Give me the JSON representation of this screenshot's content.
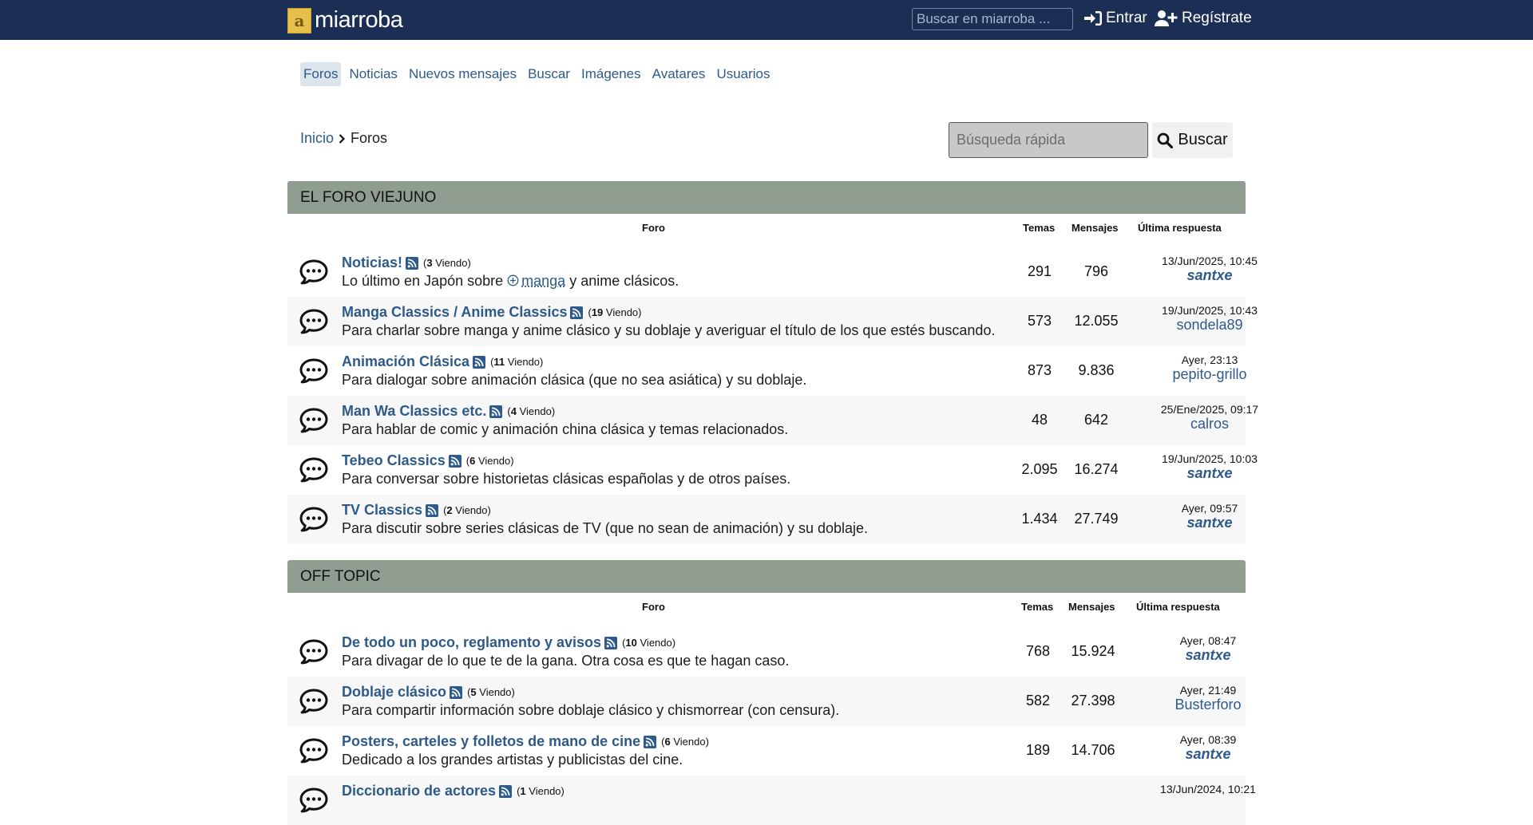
{
  "topbar": {
    "logo_mark": "a",
    "logo_text": "miarroba",
    "search_placeholder": "Buscar en miarroba ...",
    "login_label": "Entrar",
    "register_label": "Regístrate"
  },
  "nav": {
    "items": [
      "Foros",
      "Noticias",
      "Nuevos mensajes",
      "Buscar",
      "Imágenes",
      "Avatares",
      "Usuarios"
    ]
  },
  "breadcrumb": {
    "home": "Inicio",
    "current": "Foros"
  },
  "quick_search": {
    "placeholder": "Búsqueda rápida",
    "button": "Buscar"
  },
  "columns": {
    "forum": "Foro",
    "topics": "Temas",
    "posts": "Mensajes",
    "last": "Última respuesta"
  },
  "categories": [
    {
      "title": "EL FORO VIEJUNO",
      "forums": [
        {
          "title": "Noticias!",
          "viewing": "3",
          "viewing_label": "Viendo",
          "desc_pre": "Lo último en Japón sobre ",
          "desc_link": "manga",
          "desc_post": " y anime clásicos.",
          "topics": "291",
          "posts": "796",
          "last_date": "13/Jun/2025, 10:45",
          "last_user": "santxe"
        },
        {
          "title": "Manga Classics / Anime Classics",
          "viewing": "19",
          "viewing_label": "Viendo",
          "desc": "Para charlar sobre manga y anime clásico y su doblaje y averiguar el título de los que estés buscando.",
          "topics": "573",
          "posts": "12.055",
          "last_date": "19/Jun/2025, 10:43",
          "last_user": "sondela89"
        },
        {
          "title": "Animación Clásica",
          "viewing": "11",
          "viewing_label": "Viendo",
          "desc": "Para dialogar sobre animación clásica (que no sea asiática) y su doblaje.",
          "topics": "873",
          "posts": "9.836",
          "last_date": "Ayer, 23:13",
          "last_user": "pepito-grillo"
        },
        {
          "title": "Man Wa Classics etc.",
          "viewing": "4",
          "viewing_label": "Viendo",
          "desc": "Para hablar de comic y animación china clásica y temas relacionados.",
          "topics": "48",
          "posts": "642",
          "last_date": "25/Ene/2025, 09:17",
          "last_user": "calros"
        },
        {
          "title": "Tebeo Classics",
          "viewing": "6",
          "viewing_label": "Viendo",
          "desc": "Para conversar sobre historietas clásicas españolas y de otros países.",
          "topics": "2.095",
          "posts": "16.274",
          "last_date": "19/Jun/2025, 10:03",
          "last_user": "santxe"
        },
        {
          "title": "TV Classics",
          "viewing": "2",
          "viewing_label": "Viendo",
          "desc": "Para discutir sobre series clásicas de TV (que no sean de animación) y su doblaje.",
          "topics": "1.434",
          "posts": "27.749",
          "last_date": "Ayer, 09:57",
          "last_user": "santxe"
        }
      ]
    },
    {
      "title": "OFF TOPIC",
      "forums": [
        {
          "title": "De todo un poco, reglamento y avisos",
          "viewing": "10",
          "viewing_label": "Viendo",
          "desc": "Para divagar de lo que te de la gana. Otra cosa es que te hagan caso.",
          "topics": "768",
          "posts": "15.924",
          "last_date": "Ayer, 08:47",
          "last_user": "santxe"
        },
        {
          "title": "Doblaje clásico",
          "viewing": "5",
          "viewing_label": "Viendo",
          "desc": "Para compartir información sobre doblaje clásico y chismorrear (con censura).",
          "topics": "582",
          "posts": "27.398",
          "last_date": "Ayer, 21:49",
          "last_user": "Busterforo"
        },
        {
          "title": "Posters, carteles y folletos de mano de cine",
          "viewing": "6",
          "viewing_label": "Viendo",
          "desc": "Dedicado a los grandes artistas y publicistas del cine.",
          "topics": "189",
          "posts": "14.706",
          "last_date": "Ayer, 08:39",
          "last_user": "santxe"
        },
        {
          "title": "Diccionario de actores",
          "viewing": "1",
          "viewing_label": "Viendo",
          "desc": "",
          "topics": "",
          "posts": "",
          "last_date": "13/Jun/2024, 10:21",
          "last_user": ""
        }
      ]
    }
  ],
  "colors": {
    "topbar": "#1b2f55",
    "category": "#909e92",
    "link": "#2d5a8a"
  }
}
